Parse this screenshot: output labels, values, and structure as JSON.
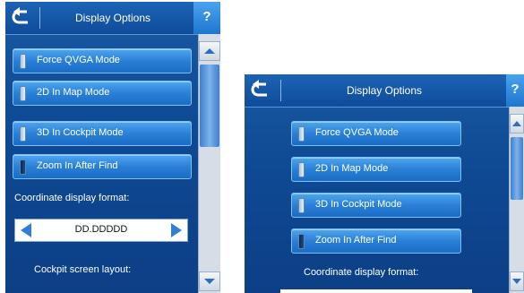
{
  "screens": [
    {
      "title": "Display Options",
      "help_label": "?",
      "options": [
        {
          "label": "Force QVGA Mode",
          "checked": false
        },
        {
          "label": "2D In Map Mode",
          "checked": false
        },
        {
          "label": "3D In Cockpit Mode",
          "checked": false
        },
        {
          "label": "Zoom In After Find",
          "checked": true
        }
      ],
      "coord_label": "Coordinate display format:",
      "coord_value": "DD.DDDDD",
      "cockpit_label": "Cockpit screen layout:"
    },
    {
      "title": "Display Options",
      "help_label": "?",
      "options": [
        {
          "label": "Force QVGA Mode",
          "checked": false
        },
        {
          "label": "2D In Map Mode",
          "checked": false
        },
        {
          "label": "3D In Cockpit Mode",
          "checked": false
        },
        {
          "label": "Zoom In After Find",
          "checked": true
        }
      ],
      "coord_label": "Coordinate display format:"
    }
  ],
  "colors": {
    "background": "#0f4a94",
    "button": "#2a80d6",
    "help": "#3a94e6"
  }
}
